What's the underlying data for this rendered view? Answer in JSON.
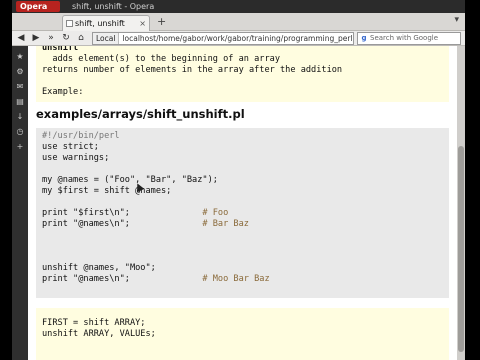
{
  "browser": {
    "app_button": "Opera",
    "window_title": "shift, unshift - Opera",
    "tab_title": "shift, unshift",
    "tab_close": "×",
    "new_tab": "+",
    "local_badge": "Local",
    "address": "localhost/home/gabor/work/gabor/training/programming_perl",
    "search_placeholder": "Search with Google"
  },
  "sidebar": {
    "icons": [
      "star-icon",
      "gear-icon",
      "mail-icon",
      "notes-icon",
      "download-icon",
      "history-icon",
      "plus-icon"
    ]
  },
  "doc": {
    "intro_lines": [
      "unshift",
      "  adds element(s) to the beginning of an array",
      "returns number of elements in the array after the addition",
      "",
      "Example:"
    ],
    "heading": "examples/arrays/shift_unshift.pl",
    "code_lines": [
      "#!/usr/bin/perl",
      "use strict;",
      "use warnings;",
      "",
      "my @names = (\"Foo\", \"Bar\", \"Baz\");",
      "my $first = shift @names;",
      "",
      "print \"$first\\n\";              # Foo",
      "print \"@names\\n\";              # Bar Baz",
      "",
      "",
      "",
      "unshift @names, \"Moo\";",
      "print \"@names\\n\";              # Moo Bar Baz"
    ],
    "syntax_lines": [
      "FIRST = shift ARRAY;",
      "unshift ARRAY, VALUEs;"
    ]
  }
}
